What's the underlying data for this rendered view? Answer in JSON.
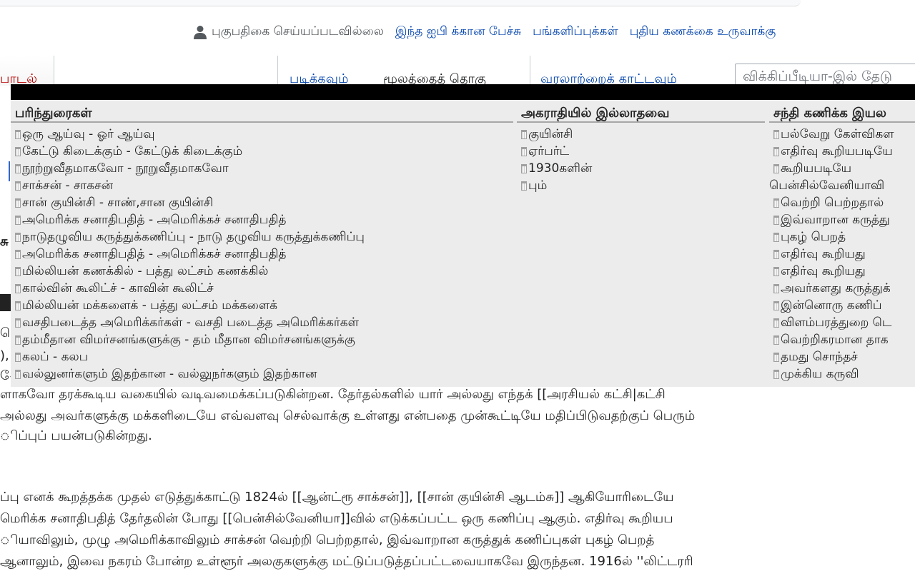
{
  "header": {
    "not_logged_in": "புகுபதிகை செய்யப்படவில்லை",
    "links": [
      "இந்த ஐபி க்கான பேச்சு",
      "பங்களிப்புக்கள்",
      "புதிய கணக்கை உருவாக்கு"
    ]
  },
  "tabs": {
    "left": "பாடல்",
    "read": "படிக்கவும்",
    "edit": "மூலத்தைத் தொகு",
    "history": "வரலாற்றைக் காட்டவும்"
  },
  "search": {
    "placeholder": "விக்கிப்பீடியா-இல் தேடு"
  },
  "overlay": {
    "columns": [
      {
        "heading": "பரிந்துரைகள்",
        "items": [
          "ஒரு ஆய்வு - ஓர் ஆய்வு",
          "கேட்டு கிடைக்கும் - கேட்டுக் கிடைக்கும்",
          "நூற்றுவீதமாகவோ - நூறுவீதமாகவோ",
          "சாக்சன் - சாகசன்",
          "சான் குயின்சி - சாண்,சான குயின்சி",
          "அமெரிக்க சனாதிபதித் - அமெரிக்கச் சனாதிபதித்",
          "நாடுதழுவிய கருத்துக்கணிப்பு - நாடு தழுவிய கருத்துக்கணிப்பு",
          "அமெரிக்க சனாதிபதித் - அமெரிக்கச் சனாதிபதித்",
          "மில்லியன் கணக்கில் - பத்து லட்சம் கணக்கில்",
          "கால்வின் கூலிட்ச் - காவின் கூலிட்ச்",
          "மில்லியன் மக்களைக் - பத்து லட்சம் மக்களைக்",
          "வசதிபடைத்த அமெரிக்கர்கள் - வசதி படைத்த அமெரிக்கர்கள்",
          "தம்மீதான விமர்சனங்களுக்கு - தம் மீதான விமர்சனங்களுக்கு",
          "கலப் - கலப",
          "வல்லுனர்களும் இதற்கான - வல்லுநர்களும் இதற்கான"
        ]
      },
      {
        "heading": "அகராதியில் இல்லாதவை",
        "items": [
          "குயின்சி",
          "ஏர்பர்ட்",
          "1930களின்",
          "பும்"
        ]
      },
      {
        "heading": "சந்தி கணிக்க இயல",
        "items": [
          "பல்வேறு கேள்விகள",
          "எதிர்வு கூறியபடியே",
          "கூறியபடியே",
          "பென்சில்வேனியாவி",
          "வெற்றி பெற்றதால்",
          "இவ்வாறான கருத்து",
          "புகழ் பெறத்",
          "எதிர்வு கூறியது",
          "எதிர்வு கூறியது",
          "அவர்களது கருத்துக்",
          "இன்னொரு கணிப்",
          "விளம்பரத்துறை டெ",
          "வெற்றிகரமான தாக",
          "தமது சொந்தச்",
          "முக்கிய கருவி"
        ]
      }
    ]
  },
  "article": {
    "left_fragments": [
      "சு",
      "ெ",
      "),",
      "ேக"
    ],
    "lines": [
      "ளாகவோ தரக்கூடிய வகையில் வடிவமைக்கப்படுகின்றன. தேர்தல்களில் யார் அல்லது எந்தக் [[அரசியல் கட்சி|கட்சி",
      "அல்லது அவர்களுக்கு மக்களிடையே எவ்வளவு செல்வாக்கு உள்ளது என்பதை முன்கூட்டியே மதிப்பிடுவதற்குப் பெரும்",
      "ிப்புப் பயன்படுகின்றது.",
      "ப்பு எனக் கூறத்தக்க முதல் எடுத்துக்காட்டு 1824ல் [[ஆன்ட்ரூ சாக்சன்]], [[சான் குயின்சி ஆடம்சு]] ஆகியோரிடையே",
      "மெரிக்க சனாதிபதித் தேர்தலின் போது [[பென்சில்வேனியா]]வில் எடுக்கப்பட்ட ஒரு கணிப்பு ஆகும். எதிர்வு கூறியப",
      "ியாவிலும், முழு அமெரிக்காவிலும் சாக்சன் வெற்றி பெற்றதால், இவ்வாறான கருத்துக் கணிப்புகள் புகழ் பெறத்",
      "ஆனாலும், இவை நகரம் போன்ற உள்ளூர் அலகுகளுக்கு மட்டுப்படுத்தப்பட்டவையாகவே இருந்தன. 1916ல் ''லிட்டரரி"
    ]
  }
}
